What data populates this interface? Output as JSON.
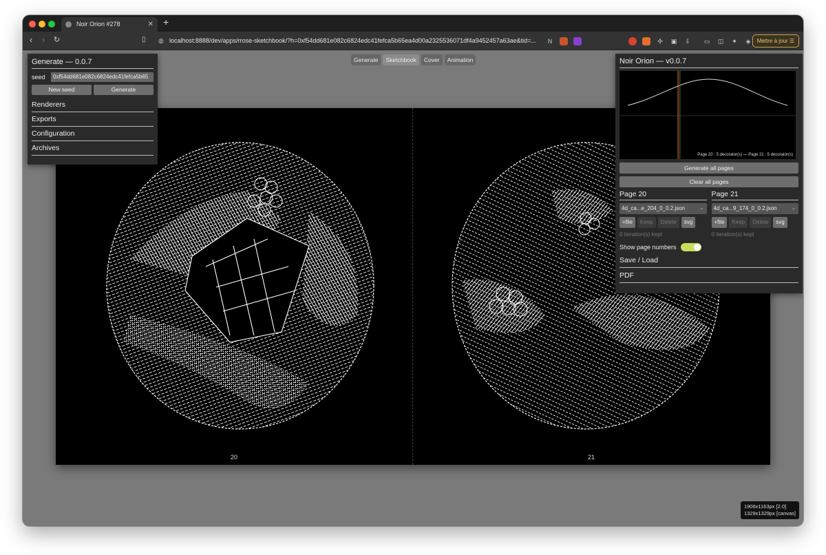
{
  "browser": {
    "tab_title": "Noir Orion #278",
    "url": "localhost:8888/dev/apps/rrose-sketchbook/?h=0xf54dd681e082c6824edc41fefca5b65ea4d00a2325536071df4a9452457a63ae&tid=...",
    "update_label": "Mettre à jour"
  },
  "modes": [
    "Generate",
    "Sketchbook",
    "Cover",
    "Animation"
  ],
  "left_panel": {
    "title": "Generate — 0.0.7",
    "seed_label": "seed",
    "seed_value": "0xf54dd681e082c6824edc41fefca5b65",
    "new_seed": "New seed",
    "generate": "Generate",
    "sections": [
      "Renderers",
      "Exports",
      "Configuration",
      "Archives"
    ]
  },
  "right_panel": {
    "title": "Noir Orion — v0.0.7",
    "graph_caption": "Page 20 : 5 decorator(s) — Page 21 : 5 decorator(s)",
    "generate_all": "Generate all pages",
    "clear_all": "Clear all pages",
    "page_left": {
      "title": "Page 20",
      "file": "4d_ca...e_204_0_0.2.json",
      "add_file": "+file",
      "keep": "Keep",
      "delete": "Delete",
      "svg": "svg",
      "kept": "0 iteration(s) kept"
    },
    "page_right": {
      "title": "Page 21",
      "file": "4d_ca...9_174_0_0.2.json",
      "add_file": "+file",
      "keep": "Keep",
      "delete": "Delete",
      "svg": "svg",
      "kept": "0 iteration(s) kept"
    },
    "show_page_numbers": "Show page numbers",
    "show_page_numbers_on": true,
    "save_load": "Save / Load",
    "pdf": "PDF"
  },
  "spread": {
    "left_page_number": "20",
    "right_page_number": "21"
  },
  "info": {
    "line1": "1906x1163px [2.0]",
    "line2": "1329x1329px [canvas]"
  },
  "colors": {
    "accent_toggle": "#c9dd5a",
    "update_border": "#c8a24a"
  }
}
